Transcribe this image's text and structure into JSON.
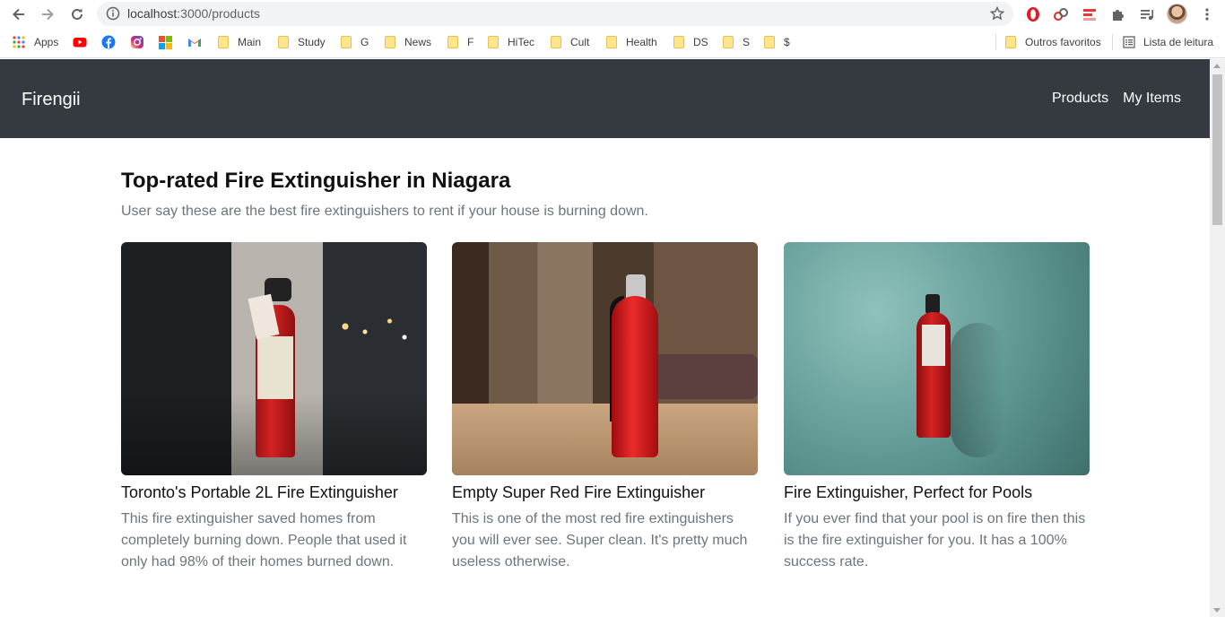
{
  "browser": {
    "url_host": "localhost",
    "url_rest": ":3000/products",
    "bookmarks": [
      {
        "label": "Apps",
        "icon": "apps-grid-icon"
      },
      {
        "label": "",
        "icon": "youtube-icon"
      },
      {
        "label": "",
        "icon": "facebook-icon"
      },
      {
        "label": "",
        "icon": "instagram-icon"
      },
      {
        "label": "",
        "icon": "microsoft-icon"
      },
      {
        "label": "",
        "icon": "gmail-icon"
      },
      {
        "label": "Main",
        "icon": "folder-icon"
      },
      {
        "label": "Study",
        "icon": "folder-icon"
      },
      {
        "label": "G",
        "icon": "folder-icon"
      },
      {
        "label": "News",
        "icon": "folder-icon"
      },
      {
        "label": "F",
        "icon": "folder-icon"
      },
      {
        "label": "HiTec",
        "icon": "folder-icon"
      },
      {
        "label": "Cult",
        "icon": "folder-icon"
      },
      {
        "label": "Health",
        "icon": "folder-icon"
      },
      {
        "label": "DS",
        "icon": "folder-icon"
      },
      {
        "label": "S",
        "icon": "folder-icon"
      },
      {
        "label": "$",
        "icon": "folder-icon"
      }
    ],
    "other_bookmarks": "Outros favoritos",
    "reading_list": "Lista de leitura"
  },
  "navbar": {
    "brand": "Firengii",
    "links": [
      "Products",
      "My Items"
    ],
    "bg_color": "#343a40"
  },
  "page": {
    "title": "Top-rated Fire Extinguisher in Niagara",
    "subtitle": "User say these are the best fire extinguishers to rent if your house is burning down."
  },
  "products": [
    {
      "title": "Toronto's Portable 2L Fire Extinguisher",
      "description": "This fire extinguisher saved homes from completely burning down. People that used it only had 98% of their homes burned down."
    },
    {
      "title": "Empty Super Red Fire Extinguisher",
      "description": "This is one of the most red fire extinguishers you will ever see. Super clean. It's pretty much useless otherwise."
    },
    {
      "title": "Fire Extinguisher, Perfect for Pools",
      "description": "If you ever find that your pool is on fire then this is the fire extinguisher for you. It has a 100% success rate."
    }
  ]
}
